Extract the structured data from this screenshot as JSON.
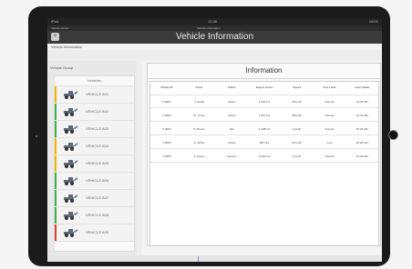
{
  "status_bar": {
    "left": "iPad",
    "center": "10:36",
    "right": "100%"
  },
  "sub_bar": {
    "left": "Vehicle Viewer",
    "center": "Vehicle Information"
  },
  "header": {
    "back_label": "<",
    "title": "Vehicle Information"
  },
  "breadcrumb": "Vehicle Information",
  "sidebar": {
    "heading": "Vehicle Group",
    "panel_title": "Vehicles",
    "items": [
      {
        "label": "VEHICLE A01",
        "color": "#f5b400"
      },
      {
        "label": "VEHICLE A02",
        "color": "#3bb44a"
      },
      {
        "label": "VEHICLE A03",
        "color": "#3bb44a"
      },
      {
        "label": "VEHICLE A04",
        "color": "#f5b400"
      },
      {
        "label": "VEHICLE A05",
        "color": "#f5b400"
      },
      {
        "label": "VEHICLE A06",
        "color": "#3bb44a"
      },
      {
        "label": "VEHICLE A07",
        "color": "#3bb44a"
      },
      {
        "label": "VEHICLE A08",
        "color": "#3bb44a"
      },
      {
        "label": "VEHICLE A09",
        "color": "#e43c3c"
      }
    ]
  },
  "main": {
    "title": "Information",
    "columns": [
      "Vehicle ID",
      "Driver",
      "Status",
      "Engine Hours",
      "Speed",
      "Fuel Level",
      "Last Update"
    ],
    "rows": [
      [
        "T-0001",
        "J. Smith",
        "Active",
        "1,234 hrs",
        "45 km/h",
        "Normal",
        "10:32 AM"
      ],
      [
        "T-0002",
        "M. Jones",
        "Active",
        "1,567 hrs",
        "38 km/h",
        "Normal",
        "10:31 AM"
      ],
      [
        "T-0003",
        "R. Brown",
        "Idle",
        "2,108 hrs",
        "0 km/h",
        "Normal",
        "10:29 AM"
      ],
      [
        "T-0004",
        "K. White",
        "Active",
        "987 hrs",
        "52 km/h",
        "Low",
        "10:28 AM"
      ],
      [
        "T-0005",
        "P. Green",
        "Service",
        "3,402 hrs",
        "0 km/h",
        "Normal",
        "10:25 AM"
      ]
    ]
  },
  "icons": {
    "back": "chevron-left-icon",
    "vehicle": "construction-vehicle-icon"
  }
}
